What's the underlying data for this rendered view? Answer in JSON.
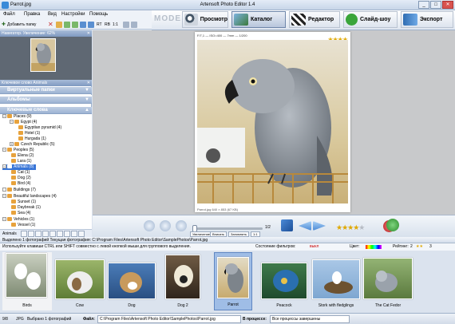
{
  "window": {
    "file": "Parrot.jpg",
    "title": "Artensoft Photo Editor 1.4",
    "minimize": "_",
    "maximize": "□",
    "close": "✕"
  },
  "menu": [
    "Файл",
    "Правка",
    "Вид",
    "Настройки",
    "Помощь"
  ],
  "toolbar": {
    "add_folder": "Добавить папку",
    "zoom_a": "RT",
    "zoom_b": "RB",
    "ratio": "1:1"
  },
  "mode": {
    "label": "MODE:",
    "buttons": [
      {
        "label": "Просмотр",
        "icon": "search-icon"
      },
      {
        "label": "Каталог",
        "icon": "catalog-icon"
      },
      {
        "label": "Редактор",
        "icon": "clapper-icon"
      },
      {
        "label": "Слайд-шоу",
        "icon": "play-icon"
      },
      {
        "label": "Экспорт",
        "icon": "export-arrow-icon"
      }
    ]
  },
  "navigator": {
    "header": "Навигатор. Увеличение: 62%"
  },
  "keywords_header": "Ключевое слово Animals",
  "sections": {
    "virtual": "Виртуальные папки",
    "albums": "Альбомы",
    "keywords": "Ключевые слова"
  },
  "tree": [
    {
      "label": "Places  (9)",
      "box": "−"
    },
    {
      "label": "Egypt  (4)",
      "box": "−"
    },
    {
      "label": "Egyptian pyramid  (4)",
      "box": ""
    },
    {
      "label": "Hotel  (1)",
      "box": ""
    },
    {
      "label": "Hurgada  (1)",
      "box": ""
    },
    {
      "label": "Czech Republic  (5)",
      "box": "+"
    },
    {
      "label": "Peoples  (5)",
      "box": "−"
    },
    {
      "label": "Elena  (2)",
      "box": ""
    },
    {
      "label": "Lara  (1)",
      "box": ""
    },
    {
      "label": "Animals  (8)",
      "box": "−"
    },
    {
      "label": "Cat  (1)",
      "box": ""
    },
    {
      "label": "Dog  (2)",
      "box": ""
    },
    {
      "label": "Bird  (4)",
      "box": ""
    },
    {
      "label": "Buildings  (7)",
      "box": ""
    },
    {
      "label": "Beautiful landscapes  (4)",
      "box": "−"
    },
    {
      "label": "Sunset  (1)",
      "box": ""
    },
    {
      "label": "Daybreak  (1)",
      "box": ""
    },
    {
      "label": "Sea  (4)",
      "box": ""
    },
    {
      "label": "Vehicles  (1)",
      "box": "−"
    },
    {
      "label": "Vessel  (1)",
      "box": ""
    }
  ],
  "left_footer": "Animals",
  "photo": {
    "info": "F/7,1 — ISO=400 — 7mm — 1/200",
    "stars": "★★★★",
    "caption": "Parrot.jpg  640 × 853 (67 KB)"
  },
  "controls": {
    "scale_label": "1/2",
    "btn_fit": "Увеличение",
    "btn_insert": "Вписать",
    "btn_remember": "Запомнить",
    "btn_ratio": "1:1",
    "rating_full": "★★★★",
    "rating_empty": "★"
  },
  "strip": {
    "bar1": "Выделено 1 фотографий   Текущая фотография: C:\\Program Files\\Artensoft Photo Editor\\SamplePhotos\\Parrot.jpg",
    "hint": "Используйте клавиши CTRL или SHIFT совместно с левой кнопкой мыши для группового выделения.",
    "filter_label": "Состояние фильтров:",
    "filter_value": "выкл",
    "color_label": "Цвет:",
    "rating_label": "Рейтинг:",
    "rating_value": "2",
    "count": "3",
    "thumbs": [
      "Birds",
      "Cow",
      "Dog",
      "Dog 2",
      "Parrot",
      "Peacock",
      "Stork with fledglings",
      "The Cat Fedor"
    ]
  },
  "status": {
    "zoom": "9/8",
    "format": "JPG",
    "selected": "Выбрано 1 фотографий",
    "file_label": "Файл:",
    "file_path": "C:\\Program Files\\Artensoft Photo Editor\\SamplePhotos\\Parrot.jpg",
    "process_label": "В процессе:",
    "process_value": "Все процессы завершены"
  },
  "colors": {
    "accent": "#3875d7",
    "star": "#e0a800"
  }
}
